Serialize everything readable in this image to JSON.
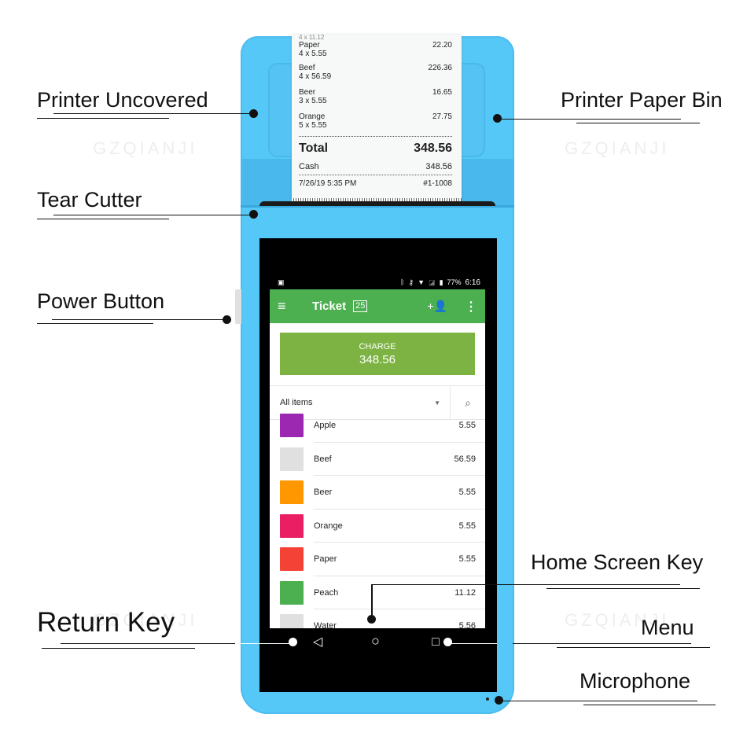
{
  "watermark": "GZQIANJI",
  "callouts": {
    "printer_uncovered": "Printer Uncovered",
    "tear_cutter": "Tear Cutter",
    "power_button": "Power Button",
    "return_key": "Return Key",
    "printer_paper_bin": "Printer Paper Bin",
    "home_screen_key": "Home Screen Key",
    "menu": "Menu",
    "microphone": "Microphone"
  },
  "receipt": {
    "cut_line": "4 x 11.12",
    "items": [
      {
        "name": "Paper",
        "qty": "4 x 5.55",
        "amount": "22.20"
      },
      {
        "name": "Beef",
        "qty": "4 x 56.59",
        "amount": "226.36"
      },
      {
        "name": "Beer",
        "qty": "3 x 5.55",
        "amount": "16.65"
      },
      {
        "name": "Orange",
        "qty": "5 x 5.55",
        "amount": "27.75"
      }
    ],
    "total_label": "Total",
    "total_value": "348.56",
    "cash_label": "Cash",
    "cash_value": "348.56",
    "datetime": "7/26/19 5:35 PM",
    "receipt_no": "#1-1008"
  },
  "status_bar": {
    "left_icon": "image-icon",
    "icons": [
      "bluetooth-icon",
      "vpn-key-icon",
      "wifi-icon",
      "no-sim-icon",
      "battery-icon"
    ],
    "battery": "77%",
    "time": "6:16"
  },
  "app": {
    "colors": {
      "appbar": "#4caf50",
      "charge": "#7cb342"
    },
    "appbar": {
      "menu_icon": "hamburger-menu-icon",
      "title": "Ticket",
      "badge": "25",
      "add_customer_icon": "add-person-icon",
      "more_icon": "more-vert-icon"
    },
    "charge": {
      "label": "CHARGE",
      "amount": "348.56"
    },
    "filter": {
      "selected": "All items",
      "search_icon": "search-icon"
    },
    "items": [
      {
        "name": "Apple",
        "price": "5.55",
        "color": "#9c27b0"
      },
      {
        "name": "Beef",
        "price": "56.59",
        "color": "#e0e0e0"
      },
      {
        "name": "Beer",
        "price": "5.55",
        "color": "#ff9800"
      },
      {
        "name": "Orange",
        "price": "5.55",
        "color": "#e91e63"
      },
      {
        "name": "Paper",
        "price": "5.55",
        "color": "#f44336"
      },
      {
        "name": "Peach",
        "price": "11.12",
        "color": "#4caf50"
      },
      {
        "name": "Water",
        "price": "5.56",
        "color": "#e0e0e0"
      }
    ]
  },
  "navbar": {
    "back": "◁",
    "home": "○",
    "recents": "□"
  },
  "device_colors": {
    "body": "#56c8f7",
    "accent": "#49b8ec"
  }
}
